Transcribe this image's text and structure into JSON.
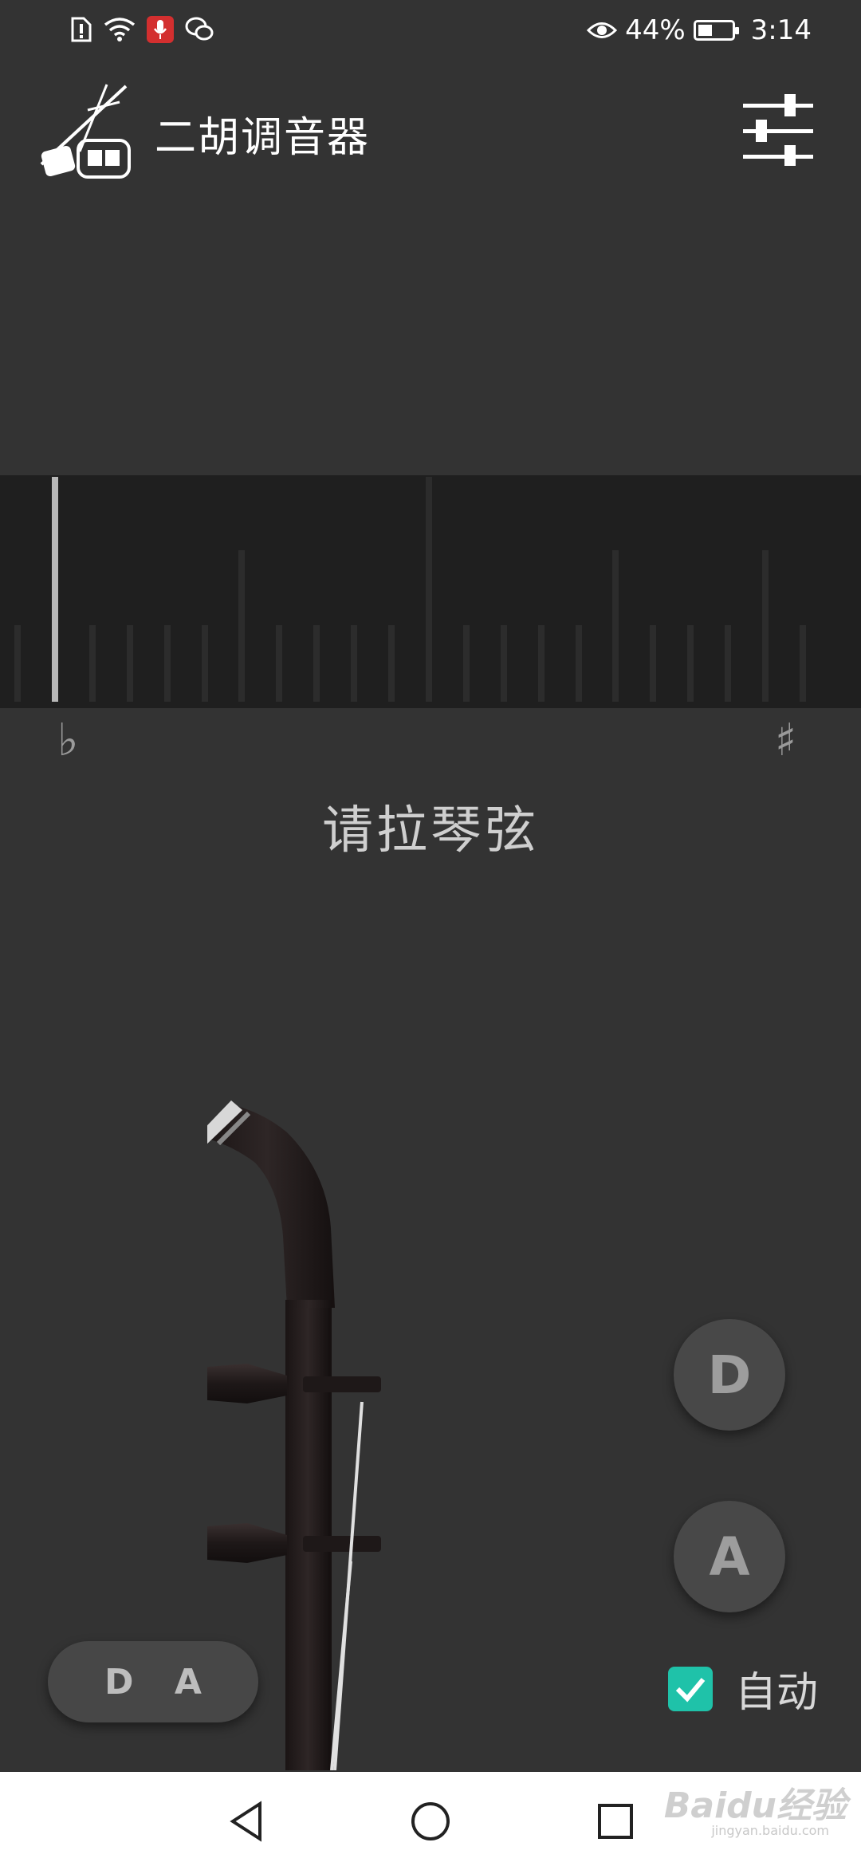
{
  "status_bar": {
    "battery_percent": "44%",
    "time": "3:14",
    "icons": [
      "sim-alert-icon",
      "wifi-icon",
      "microphone-icon",
      "wechat-icon",
      "eye-icon",
      "battery-icon"
    ],
    "battery_level": 0.44
  },
  "app_bar": {
    "title": "二胡调音器",
    "logo_icon": "erhu-logo-icon",
    "settings_icon": "sliders-icon"
  },
  "meter": {
    "flat_symbol": "♭",
    "sharp_symbol": "♯",
    "needle_position": 0.06
  },
  "prompt": "请拉琴弦",
  "strings": {
    "inner_label": "D",
    "outer_label": "A"
  },
  "tuning_mode": {
    "label": "D A"
  },
  "auto": {
    "label": "自动",
    "checked": true
  },
  "colors": {
    "accent": "#1fc2a9",
    "background": "#333333",
    "meter_bg": "#1f1f1f"
  },
  "watermark": {
    "text": "Baidu经验",
    "sub": "jingyan.baidu.com"
  }
}
